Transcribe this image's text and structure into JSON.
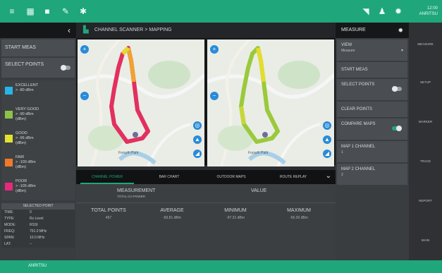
{
  "topbar": {
    "icons": [
      "menu-icon",
      "grid-icon",
      "folder-icon",
      "edit-icon",
      "settings-icon"
    ],
    "right_icons": [
      "signal-icon",
      "user-icon",
      "gear-icon"
    ],
    "status_line1": "12:00",
    "status_line2": "ANRITSU"
  },
  "left": {
    "start_label": "START MEAS",
    "select_points_label": "SELECT POINTS",
    "select_points_toggle": "OFF",
    "legend": [
      {
        "color": "#27b5e8",
        "lines": [
          "EXCELLENT",
          "> -80 dBm"
        ]
      },
      {
        "color": "#8bc34a",
        "lines": [
          "VERY GOOD",
          "> -90 dBm",
          "(dBm)"
        ]
      },
      {
        "color": "#e3e130",
        "lines": [
          "GOOD",
          "> -95 dBm",
          "(dBm)"
        ]
      },
      {
        "color": "#ef7a2b",
        "lines": [
          "FAIR",
          "> -100 dBm",
          "(dBm)"
        ]
      },
      {
        "color": "#e8287a",
        "lines": [
          "POOR",
          "> -105 dBm",
          "(dBm)"
        ]
      }
    ],
    "selected_title": "SELECTED POINT",
    "selected_rows": [
      {
        "k": "TIME:",
        "v": "0"
      },
      {
        "k": "TYPE:",
        "v": "Rx Level"
      },
      {
        "k": "MODE:",
        "v": "RSSI"
      },
      {
        "k": "FREQ:",
        "v": "751.0 MHz"
      },
      {
        "k": "SPAN:",
        "v": "10.0 MHz"
      },
      {
        "k": "LAT:",
        "v": "--"
      }
    ]
  },
  "center": {
    "breadcrumb": "CHANNEL SCANNER > MAPPING",
    "tabs": [
      "CHANNEL POWER",
      "BAR CHART",
      "OUTDOOR MAPS",
      "ROUTE REPLAY"
    ],
    "active_tab": 0,
    "stats": {
      "measurement_label": "MEASUREMENT",
      "measurement_sub": "TOTAL CH POWER",
      "value_label": "VALUE",
      "columns": [
        {
          "k": "TOTAL POINTS",
          "v": "457"
        },
        {
          "k": "AVERAGE",
          "v": "-83.81 dBm"
        },
        {
          "k": "MINIMUM",
          "v": "-97.31 dBm"
        },
        {
          "k": "MAXIMUM",
          "v": "-56.30 dBm"
        }
      ]
    }
  },
  "right": {
    "title": "MEASURE",
    "view_label": "VIEW",
    "view_value": "Measure",
    "start_label": "START MEAS",
    "select_points_label": "SELECT POINTS",
    "select_toggle": "OFF",
    "clear_points_label": "CLEAR POINTS",
    "compare_label": "COMPARE MAPS",
    "compare_toggle": "ON",
    "map1_label": "MAP 1 CHANNEL",
    "map1_value": "1",
    "map2_label": "MAP 2 CHANNEL",
    "map2_value": "2"
  },
  "rnav": [
    "MEASURE",
    "SETUP",
    "MARKER",
    "TRACE",
    "REPORT",
    "MAIN"
  ],
  "bottombar": {
    "label": "ANRITSU"
  }
}
